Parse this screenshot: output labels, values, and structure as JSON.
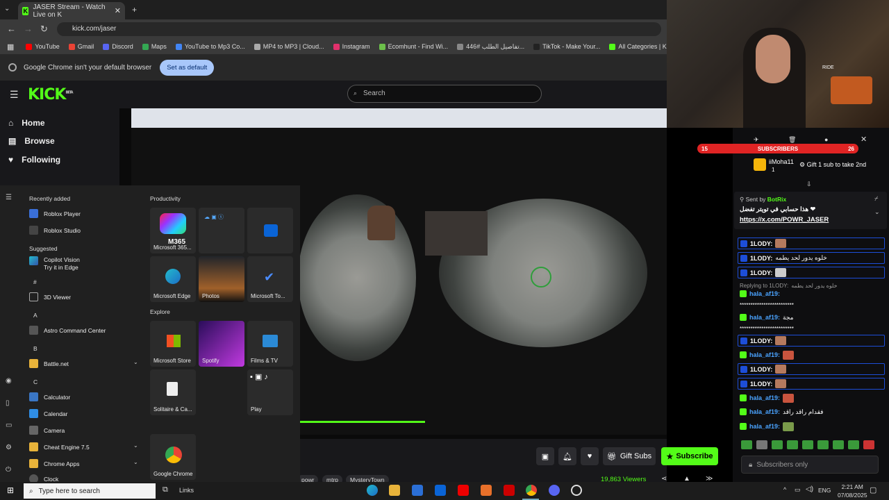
{
  "browser": {
    "tab_title": "JASER Stream - Watch Live on K",
    "tab_close": "✕",
    "new_tab": "+",
    "url": "kick.com/jaser",
    "bookmarks": [
      "YouTube",
      "Gmail",
      "Discord",
      "Maps",
      "YouTube to Mp3 Co...",
      "MP4 to MP3 | Cloud...",
      "Instagram",
      "Ecomhunt - Find Wi...",
      "تفاصيل الطلب #446...",
      "TikTok - Make Your...",
      "All Categories | Kick"
    ],
    "bookmark_colors": [
      "#ff0000",
      "#ea4335",
      "#5865f2",
      "#34a853",
      "#4285f4",
      "#aaaaaa",
      "#e1306c",
      "#6cc04a",
      "#888888",
      "#222222",
      "#53fc18"
    ],
    "infobar_text": "Google Chrome isn't your default browser",
    "infobar_button": "Set as default"
  },
  "kick": {
    "logo": "KICK",
    "beta": "BETA",
    "search_placeholder": "Search",
    "nav": [
      "Home",
      "Browse",
      "Following"
    ],
    "buttons": {
      "gift": "Gift Subs",
      "subscribe": "Subscribe"
    },
    "viewers": "19,863 Viewers",
    "tags": [
      "powr",
      "mtrp",
      "MysteryTown"
    ]
  },
  "start_menu": {
    "recently_added_label": "Recently added",
    "recent": [
      "Roblox Player",
      "Roblox Studio"
    ],
    "suggested_label": "Suggested",
    "suggested_title": "Copilot Vision",
    "suggested_sub": "Try it in Edge",
    "letters": [
      "#",
      "A",
      "B",
      "C"
    ],
    "apps": [
      "3D Viewer",
      "Astro Command Center",
      "Battle.net",
      "Calculator",
      "Calendar",
      "Camera",
      "Cheat Engine 7.5",
      "Chrome Apps",
      "Clock"
    ],
    "productivity_label": "Productivity",
    "explore_label": "Explore",
    "tiles": [
      "Microsoft 365...",
      "Microsoft Edge",
      "Photos",
      "Microsoft To...",
      "Microsoft Store",
      "Spotify",
      "Films & TV",
      "Solitaire & Ca...",
      "Play",
      "Google Chrome"
    ],
    "m365": "M365"
  },
  "taskbar": {
    "search_placeholder": "Type here to search",
    "links": "Links",
    "lang": "ENG",
    "time": "2:21 AM",
    "date": "07/08/2025"
  },
  "webcam": {
    "sign": "RIDE"
  },
  "chat": {
    "sub_left": "15",
    "sub_label": "SUBSCRIBERS",
    "sub_right": "26",
    "top_gifter": "iiMoha11",
    "top_gifter_count": "1",
    "gift_prompt": "Gift 1 sub to take 2nd",
    "pinned_sender_prefix": "Sent by",
    "pinned_sender": "BotRix",
    "pinned_text": "هذا حسابي في تويتر تفضل ❤",
    "pinned_link": "https://x.com/POWR_JASER",
    "messages": [
      {
        "nick": "1LODY:",
        "text": ""
      },
      {
        "nick": "1LODY:",
        "text": "خلوه يدور لحد يطمه"
      },
      {
        "nick": "1LODY:",
        "text": ""
      },
      {
        "nick": "hala_af19:",
        "text": ""
      },
      {
        "nick": "hala_af19:",
        "text": "مجة"
      },
      {
        "nick": "1LODY:",
        "text": ""
      },
      {
        "nick": "hala_af19:",
        "text": ""
      },
      {
        "nick": "1LODY:",
        "text": ""
      },
      {
        "nick": "1LODY:",
        "text": ""
      },
      {
        "nick": "hala_af19:",
        "text": ""
      },
      {
        "nick": "hala_af19:",
        "text": "فقدام راقد راقد"
      },
      {
        "nick": "hala_af19:",
        "text": ""
      }
    ],
    "reply_prefix": "Replying to 1LODY:",
    "reply_quote": "خلوه يدور لحد يطمه",
    "stars": "*************************",
    "input_placeholder": "Subscribers only"
  },
  "colors": {
    "kick_green": "#53fc18",
    "subscriber_red": "#e02424",
    "chat_blue": "#1d4ed8"
  }
}
